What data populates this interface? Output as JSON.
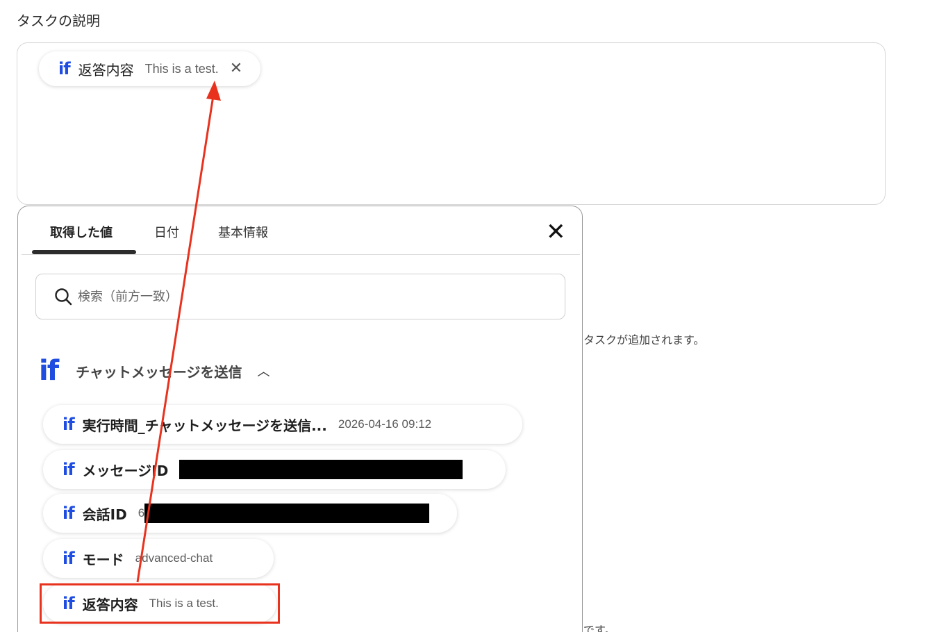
{
  "page": {
    "section_label": "タスクの説明",
    "side_text_1": "タスクが追加されます。",
    "side_text_2": "です。"
  },
  "top_chip": {
    "icon": "if-icon",
    "label": "返答内容",
    "value": "This is a test.",
    "remove_glyph": "✕"
  },
  "panel": {
    "tabs": [
      {
        "label": "取得した値",
        "active": true
      },
      {
        "label": "日付",
        "active": false
      },
      {
        "label": "基本情報",
        "active": false
      }
    ],
    "close_glyph": "✕",
    "search": {
      "placeholder": "検索（前方一致）",
      "value": ""
    },
    "group": {
      "title": "チャットメッセージを送信",
      "icon": "if-icon",
      "expanded": true,
      "chevron_glyph": "︿"
    },
    "items": [
      {
        "label": "実行時間_チャットメッセージを送信...",
        "value": "2026-04-16 09:12",
        "redacted": false
      },
      {
        "label": "メッセージID",
        "value": "",
        "redacted": true
      },
      {
        "label": "会話ID",
        "value": "6",
        "redacted": true
      },
      {
        "label": "モード",
        "value": "advanced-chat",
        "redacted": false
      },
      {
        "label": "返答内容",
        "value": "This is a test.",
        "redacted": false,
        "highlighted": true
      }
    ]
  },
  "colors": {
    "if_brand": "#1f4de0",
    "annotation": "#e8321e"
  }
}
